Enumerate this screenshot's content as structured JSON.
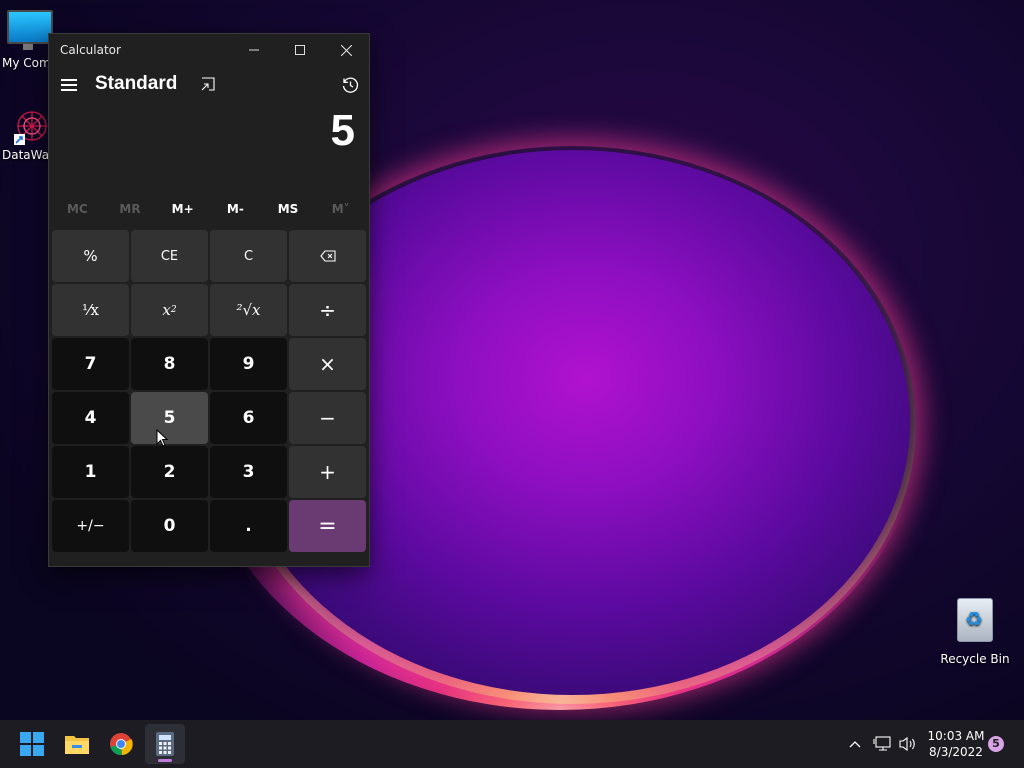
{
  "desktop": {
    "icons": [
      {
        "label": "My Com"
      },
      {
        "label": "DataWag"
      },
      {
        "label": "Recycle Bin"
      }
    ]
  },
  "calculator": {
    "window_title": "Calculator",
    "mode": "Standard",
    "display_value": "5",
    "memory": [
      "MC",
      "MR",
      "M+",
      "M-",
      "MS",
      "M˅"
    ],
    "memory_enabled": [
      false,
      false,
      true,
      true,
      true,
      false
    ],
    "keys": {
      "percent": "%",
      "ce": "CE",
      "c": "C",
      "reciprocal": "⅟x",
      "square": "x",
      "square_sup": "2",
      "sqrt": "²√x",
      "divide": "÷",
      "multiply": "×",
      "minus": "−",
      "plus": "+",
      "equals": "=",
      "n7": "7",
      "n8": "8",
      "n9": "9",
      "n4": "4",
      "n5": "5",
      "n6": "6",
      "n1": "1",
      "n2": "2",
      "n3": "3",
      "negate": "+/−",
      "n0": "0",
      "decimal": "."
    },
    "colors": {
      "equals_accent": "#6a3a72",
      "window_bg": "#202020"
    }
  },
  "taskbar": {
    "apps": [
      "start-icon",
      "file-explorer-icon",
      "chrome-icon",
      "calculator-icon"
    ],
    "active_app": "calculator-icon",
    "clock_time": "10:03 AM",
    "clock_date": "8/3/2022",
    "notification_count": "5"
  }
}
